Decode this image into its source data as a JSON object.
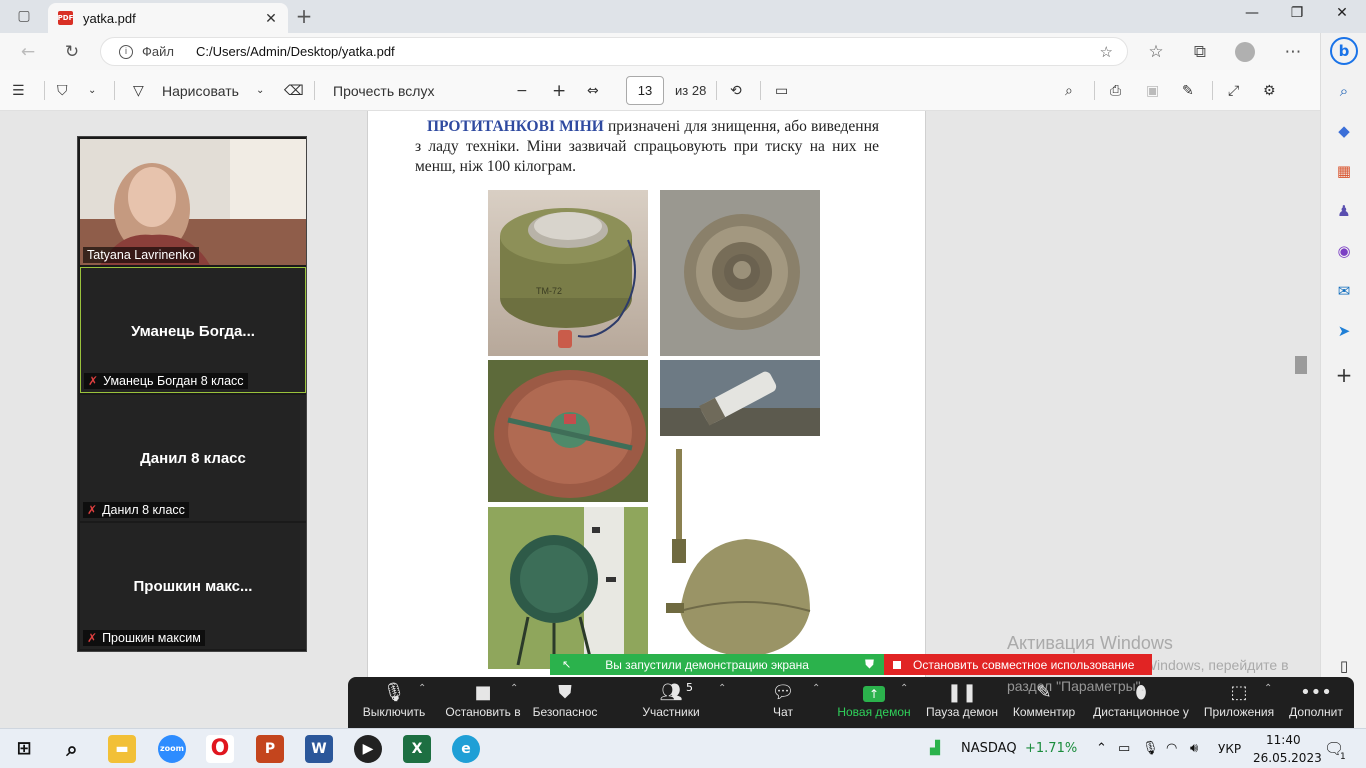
{
  "browser": {
    "tab_title": "yatka.pdf",
    "address_protocol": "Файл",
    "address_url": "C:/Users/Admin/Desktop/yatka.pdf"
  },
  "pdf_toolbar": {
    "draw_label": "Нарисовать",
    "read_aloud_label": "Прочесть вслух",
    "current_page": "13",
    "page_total": "из 28"
  },
  "document": {
    "heading": "ПРОТИТАНКОВІ МІНИ",
    "paragraph": " призначені для знищення, або виведення з ладу техніки. Міни зазвичай спрацьовують при тиску на них не менш, ніж 100 кілограм.",
    "photo_label": "ТМ-72"
  },
  "zoom": {
    "self_name": "Tatyana Lavrinenko",
    "participants": [
      {
        "display": "Уманець  Богда...",
        "label": "Уманець Богдан 8 класс"
      },
      {
        "display": "Данил 8 класс",
        "label": "Данил 8 класс"
      },
      {
        "display": "Прошкин  макс...",
        "label": "Прошкин максим"
      }
    ],
    "share_started": "Вы запустили демонстрацию экрана",
    "stop_share": "Остановить совместное использование",
    "controls": {
      "mute": "Выключить",
      "video": "Остановить в",
      "security": "Безопаснос",
      "participants": "Участники",
      "participants_count": "5",
      "chat": "Чат",
      "new_share": "Новая демон",
      "pause_share": "Пауза демон",
      "annotate": "Комментир",
      "remote": "Дистанционное у",
      "apps": "Приложения",
      "more": "Дополнит"
    }
  },
  "watermark": {
    "title": "Активация Windows",
    "line1": "Чтобы активировать Windows, перейдите в",
    "line2": "раздел \"Параметры\"."
  },
  "taskbar": {
    "stock_name": "NASDAQ",
    "stock_change": "+1.71%",
    "language": "УКР",
    "time": "11:40",
    "date": "26.05.2023",
    "notification_count": "1"
  },
  "colors": {
    "heading_blue": "#2f4aa0",
    "zoom_green": "#2bb24c",
    "zoom_red": "#e12424",
    "active_speaker_border": "#9ac23c"
  }
}
